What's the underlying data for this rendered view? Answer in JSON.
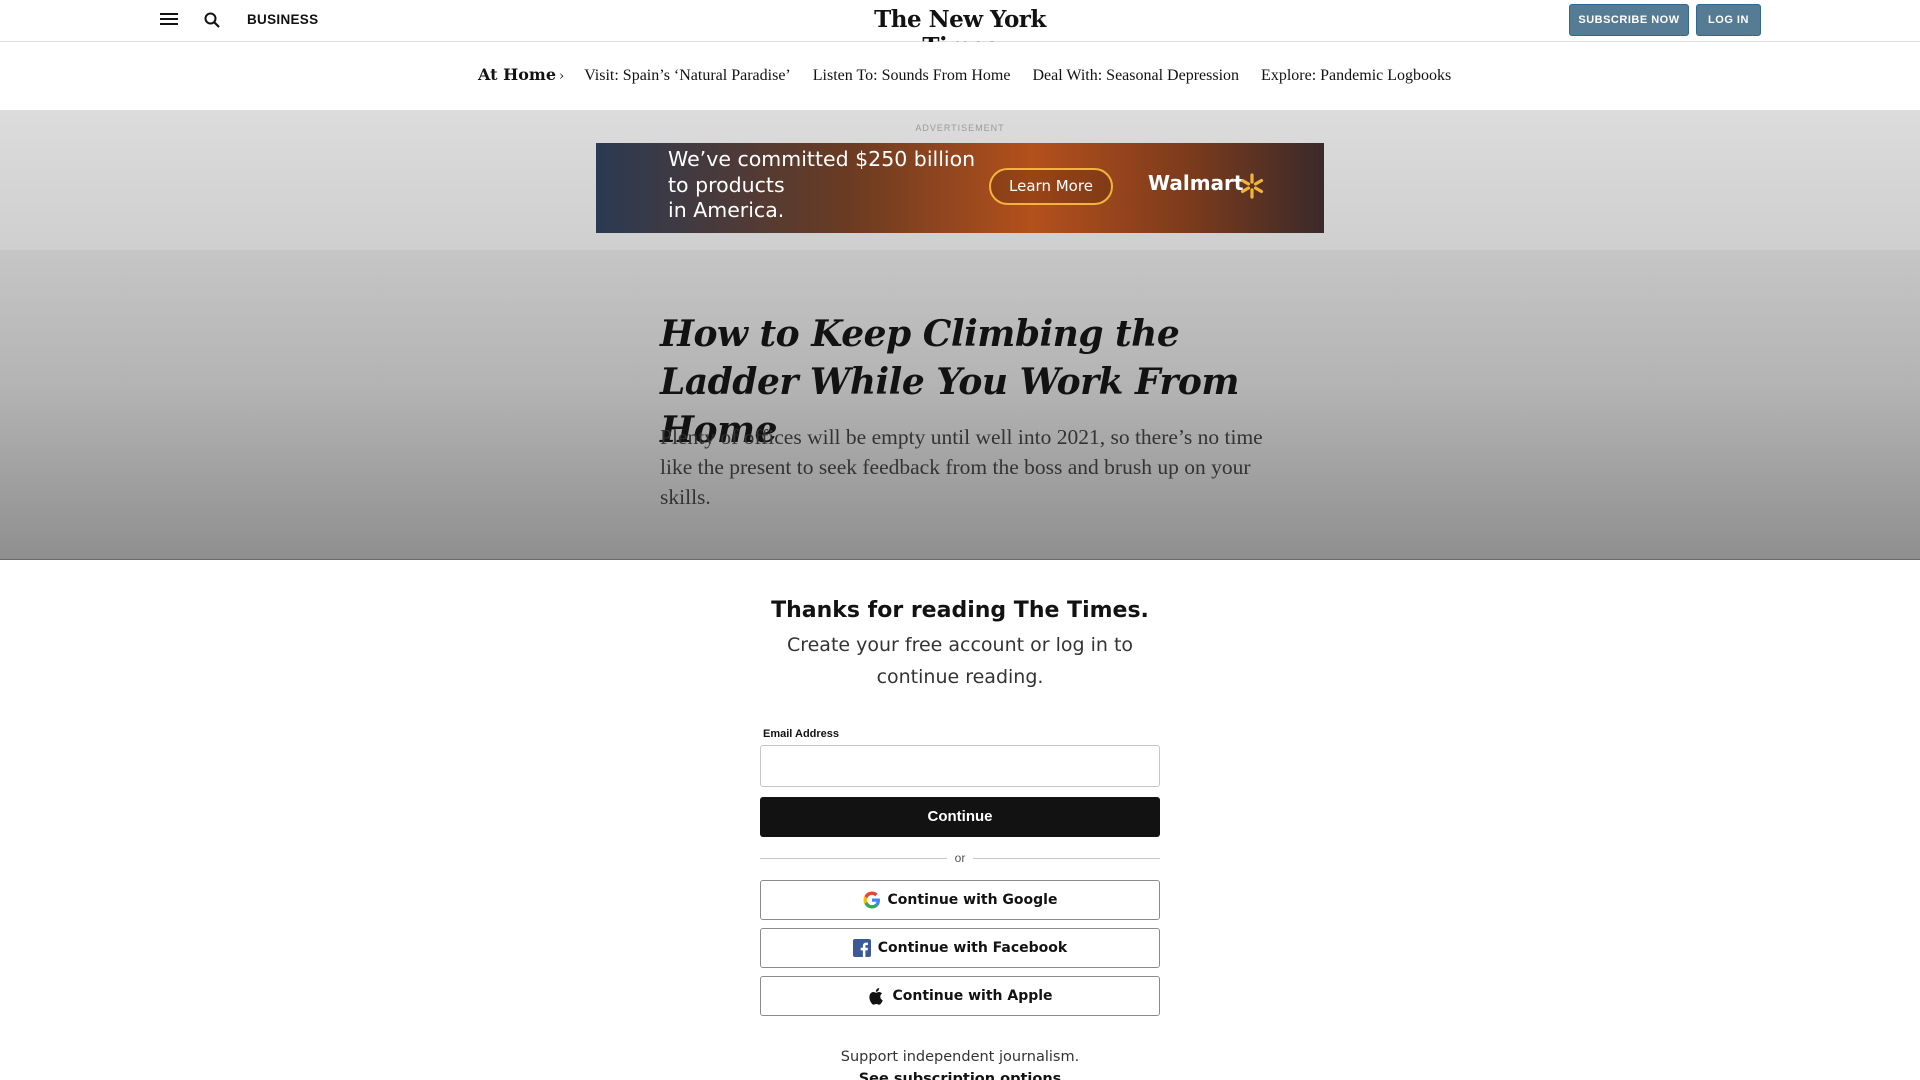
{
  "header": {
    "section": "BUSINESS",
    "logo": "The New York Times",
    "subscribe_label": "SUBSCRIBE NOW",
    "login_label": "LOG IN"
  },
  "subnav": {
    "head": "At Home",
    "items": [
      "Visit: Spain’s ‘Natural Paradise’",
      "Listen To: Sounds From Home",
      "Deal With: Seasonal Depression",
      "Explore: Pandemic Logbooks"
    ]
  },
  "ad": {
    "label": "ADVERTISEMENT",
    "line1": "We’ve committed $250 billion",
    "line2": "to products",
    "line3": "in America.",
    "cta": "Learn More",
    "brand": "Walmart"
  },
  "article": {
    "headline": "How to Keep Climbing the Ladder While You Work From Home",
    "summary": "Plenty of offices will be empty until well into 2021, so there’s no time like the present to seek feedback from the boss and brush up on your skills."
  },
  "registration": {
    "title": "Thanks for reading The Times.",
    "subtitle": "Create your free account or log in to continue reading.",
    "email_label": "Email Address",
    "email_value": "",
    "continue_label": "Continue",
    "or_label": "or",
    "google_label": "Continue with Google",
    "facebook_label": "Continue with Facebook",
    "apple_label": "Continue with Apple",
    "support_text": "Support independent journalism.",
    "see_options": "See subscription options"
  },
  "colors": {
    "button_blue": "#567b95",
    "continue_bg": "#121212",
    "facebook_blue": "#3b5998"
  }
}
